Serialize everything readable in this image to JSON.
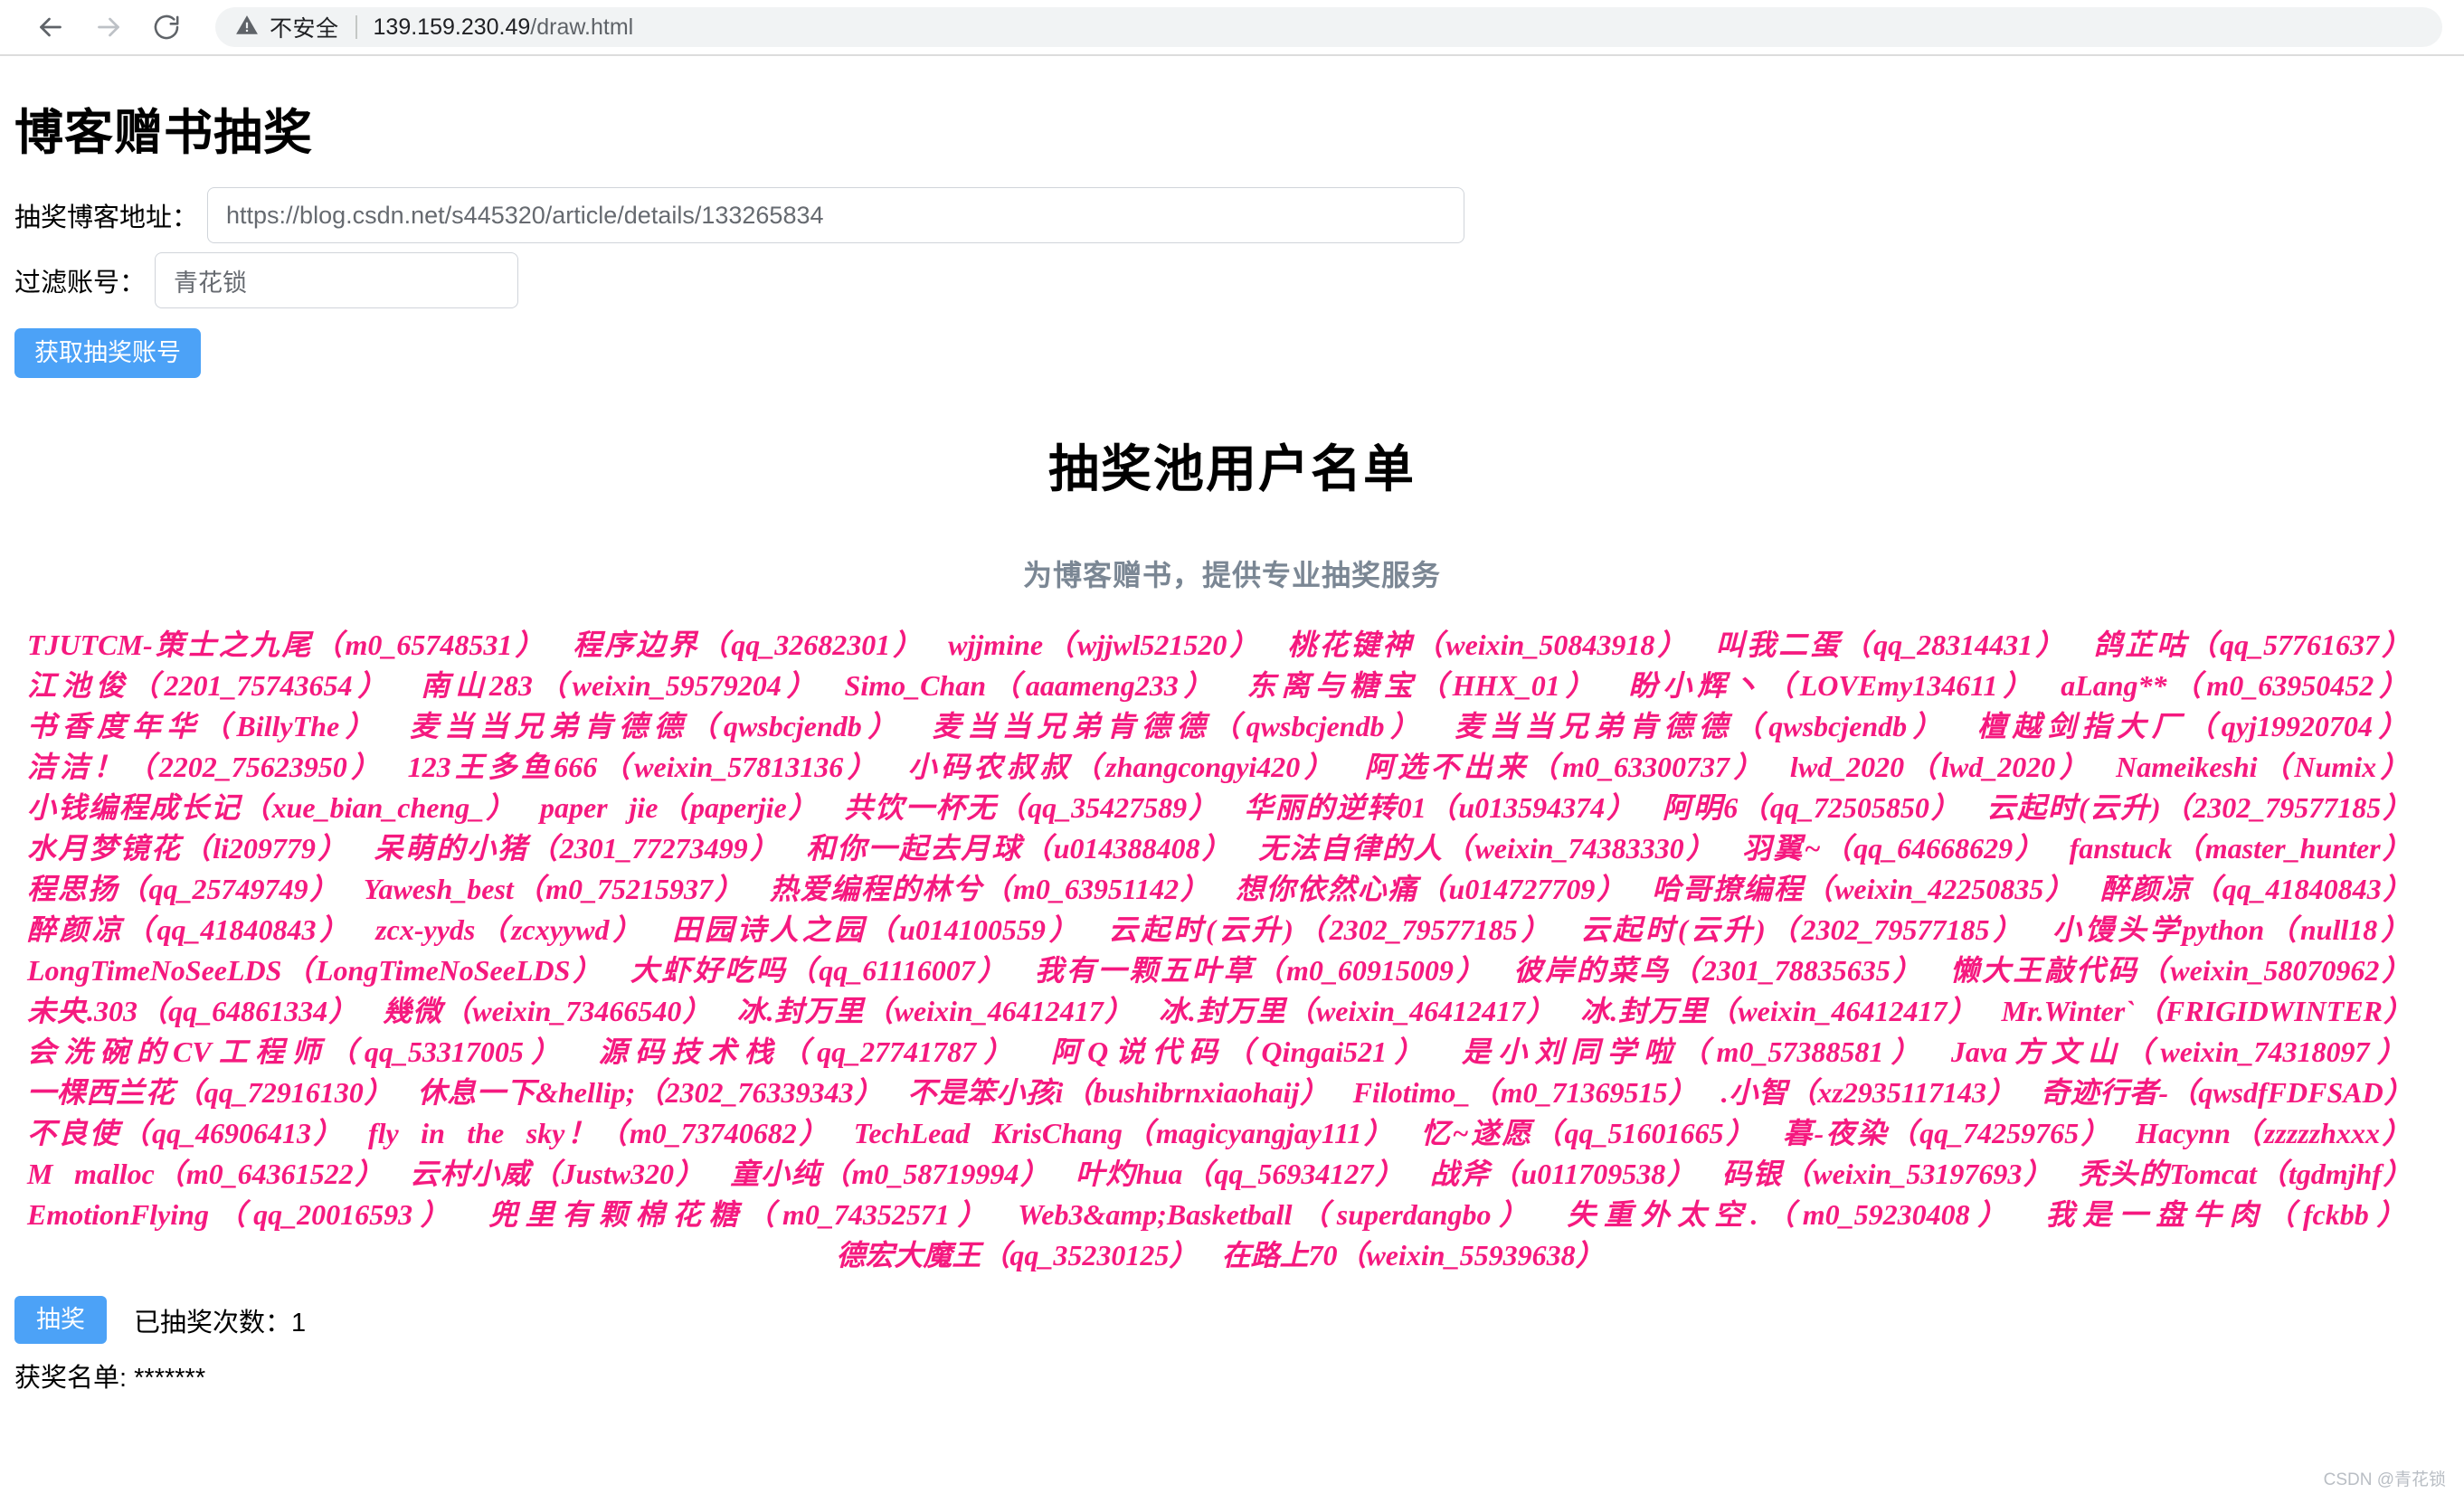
{
  "browser": {
    "back_icon": "back-arrow-icon",
    "forward_icon": "forward-arrow-icon",
    "reload_icon": "reload-icon",
    "security_icon": "warning-triangle-icon",
    "security_label": "不安全",
    "url_host": "139.159.230.49",
    "url_path": "/draw.html"
  },
  "page": {
    "title": "博客赠书抽奖",
    "pool_title": "抽奖池用户名单",
    "pool_subtitle": "为博客赠书，提供专业抽奖服务"
  },
  "form": {
    "blog_url_label": "抽奖博客地址：",
    "blog_url_value": "https://blog.csdn.net/s445320/article/details/133265834",
    "filter_label": "过滤账号：",
    "filter_value": "青花锁",
    "fetch_button": "获取抽奖账号"
  },
  "draw": {
    "draw_button": "抽奖",
    "count_label": "已抽奖次数：",
    "count_value": "1",
    "winners_label": "获奖名单:",
    "winners_value": "*******"
  },
  "watermark": "CSDN @青花锁",
  "colors": {
    "accent": "#4ca2f7",
    "pool_text": "#f5197f",
    "subtitle": "#7b8794"
  },
  "users": [
    "TJUTCM-策士之九尾（m0_65748531）",
    "程序边界（qq_32682301）",
    "wjjmine（wjjwl521520）",
    "桃花键神（weixin_50843918）",
    "叫我二蛋（qq_28314431）",
    "鸽芷咕（qq_57761637）",
    "江池俊（2201_75743654）",
    "南山283（weixin_59579204）",
    "Simo_Chan（aaameng233）",
    "东离与糖宝（HHX_01）",
    "盼小辉丶（LOVEmy134611）",
    "aLang**（m0_63950452）",
    "书香度年华（BillyThe）",
    "麦当当兄弟肯德德（qwsbcjendb）",
    "麦当当兄弟肯德德（qwsbcjendb）",
    "麦当当兄弟肯德德（qwsbcjendb）",
    "檀越剑指大厂（qyj19920704）",
    "洁洁！（2202_75623950）",
    "123王多鱼666（weixin_57813136）",
    "小码农叔叔（zhangcongyi420）",
    "阿选不出来（m0_63300737）",
    "lwd_2020（lwd_2020）",
    "Nameikeshi（Numix）",
    "小钱编程成长记（xue_bian_cheng_）",
    "paper jie（paperjie）",
    "共饮一杯无（qq_35427589）",
    "华丽的逆转01（u013594374）",
    "阿明6（qq_72505850）",
    "云起时(云升)（2302_79577185）",
    "水月梦镜花（li209779）",
    "呆萌的小猪（2301_77273499）",
    "和你一起去月球（u014388408）",
    "无法自律的人（weixin_74383330）",
    "羽翼~（qq_64668629）",
    "fanstuck（master_hunter）",
    "程思扬（qq_25749749）",
    "Yawesh_best（m0_75215937）",
    "热爱编程的林兮（m0_63951142）",
    "想你依然心痛（u014727709）",
    "哈哥撩编程（weixin_42250835）",
    "醉颜凉（qq_41840843）",
    "醉颜凉（qq_41840843）",
    "zcx-yyds（zcxyywd）",
    "田园诗人之园（u014100559）",
    "云起时(云升)（2302_79577185）",
    "云起时(云升)（2302_79577185）",
    "小馒头学python（null18）",
    "LongTimeNoSeeLDS（LongTimeNoSeeLDS）",
    "大虾好吃吗（qq_61116007）",
    "我有一颗五叶草（m0_60915009）",
    "彼岸的菜鸟（2301_78835635）",
    "懒大王敲代码（weixin_58070962）",
    "未央.303（qq_64861334）",
    "幾微（weixin_73466540）",
    "冰.封万里（weixin_46412417）",
    "冰.封万里（weixin_46412417）",
    "冰.封万里（weixin_46412417）",
    "Mr.Winter`（FRIGIDWINTER）",
    "会洗碗的CV工程师（qq_53317005）",
    "源码技术栈（qq_27741787）",
    "阿Q说代码（Qingai521）",
    "是小刘同学啦（m0_57388581）",
    "Java方文山（weixin_74318097）",
    "一棵西兰花（qq_72916130）",
    "休息一下&hellip;（2302_76339343）",
    "不是笨小孩i（bushibrnxiaohaij）",
    "Filotimo_（m0_71369515）",
    ".小智（xz2935117143）",
    "奇迹行者-（qwsdfFDFSAD）",
    "不良使（qq_46906413）",
    "fly in the sky！（m0_73740682）",
    "TechLead KrisChang（magicyangjay111）",
    "忆~遂愿（qq_51601665）",
    "暮-夜染（qq_74259765）",
    "Hacynn（zzzzzhxxx）",
    "M malloc（m0_64361522）",
    "云村小威（Justw320）",
    "童小纯（m0_58719994）",
    "叶灼hua（qq_56934127）",
    "战斧（u011709538）",
    "码银（weixin_53197693）",
    "秃头的Tomcat（tgdmjhf）",
    "EmotionFlying（qq_20016593）",
    "兜里有颗棉花糖（m0_74352571）",
    "Web3&amp;Basketball（superdangbo）",
    "失重外太空.（m0_59230408）",
    "我是一盘牛肉（fckbb）",
    "德宏大魔王（qq_35230125）",
    "在路上70（weixin_55939638）"
  ]
}
